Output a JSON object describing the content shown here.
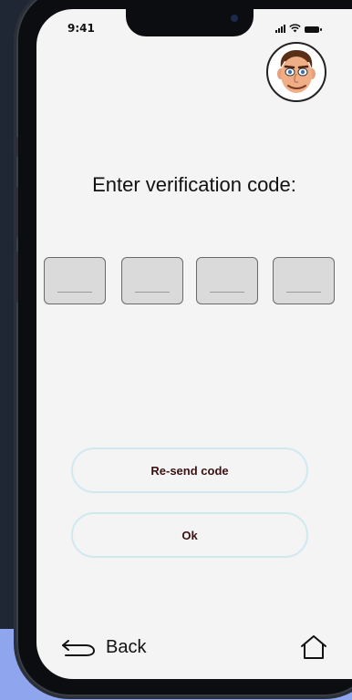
{
  "status_bar": {
    "time": "9:41"
  },
  "header": {
    "avatar": "cartoon-man-avatar"
  },
  "verification": {
    "title": "Enter  verification code:",
    "code_digits": [
      "",
      "",
      "",
      ""
    ]
  },
  "actions": {
    "resend_label": "Re-send code",
    "ok_label": "Ok"
  },
  "footer": {
    "back_label": "Back",
    "back_icon": "back-arrow-icon",
    "home_icon": "home-icon"
  },
  "colors": {
    "screen_bg": "#f4f4f4",
    "button_border": "#cfe9f0",
    "button_text": "#3a1212",
    "code_box_bg": "#dadada",
    "backdrop": "#1f2735",
    "backdrop_accent": "#8fa6ef"
  }
}
